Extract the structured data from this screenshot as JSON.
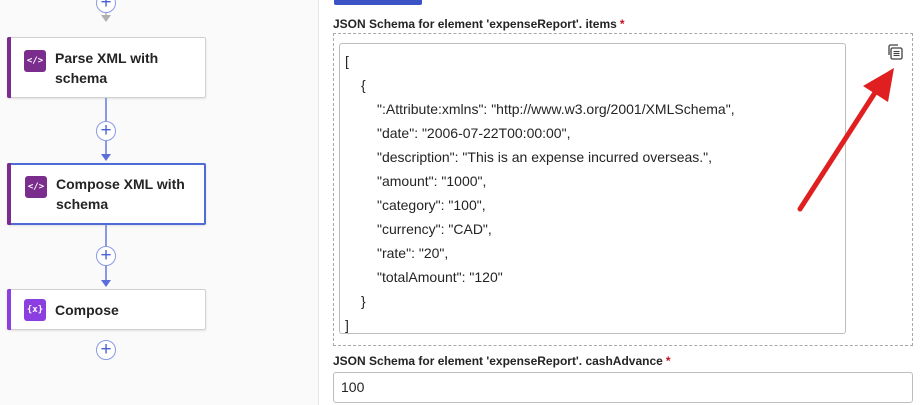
{
  "workflow": {
    "steps": [
      {
        "title": "Parse XML with schema",
        "icon": "xml-action-icon",
        "color": "#7b2d8e",
        "selected": false
      },
      {
        "title": "Compose XML with schema",
        "icon": "xml-action-icon",
        "color": "#7b2d8e",
        "selected": true
      },
      {
        "title": "Compose",
        "icon": "compose-braces-icon",
        "color": "#8b3fe0",
        "selected": false
      }
    ],
    "add_symbol": "+",
    "icon_glyphs": {
      "xml": "</>",
      "compose": "{x}"
    }
  },
  "panel": {
    "items_label": "JSON Schema for element 'expenseReport'. items",
    "items_required": "*",
    "items_json_lines": [
      "[",
      "{",
      "\":Attribute:xmlns\": \"http://www.w3.org/2001/XMLSchema\",",
      "\"date\": \"2006-07-22T00:00:00\",",
      "\"description\": \"This is an expense incurred overseas.\",",
      "\"amount\": \"1000\",",
      "\"category\": \"100\",",
      "\"currency\": \"CAD\",",
      "\"rate\": \"20\",",
      "\"totalAmount\": \"120\"",
      "}",
      "]"
    ],
    "cash_label": "JSON Schema for element 'expenseReport'. cashAdvance",
    "cash_required": "*",
    "cash_value": "100",
    "copy_icon": "copy-to-array-icon",
    "annotation_arrow_color": "#e02020",
    "accent_color": "#3b53c5"
  }
}
